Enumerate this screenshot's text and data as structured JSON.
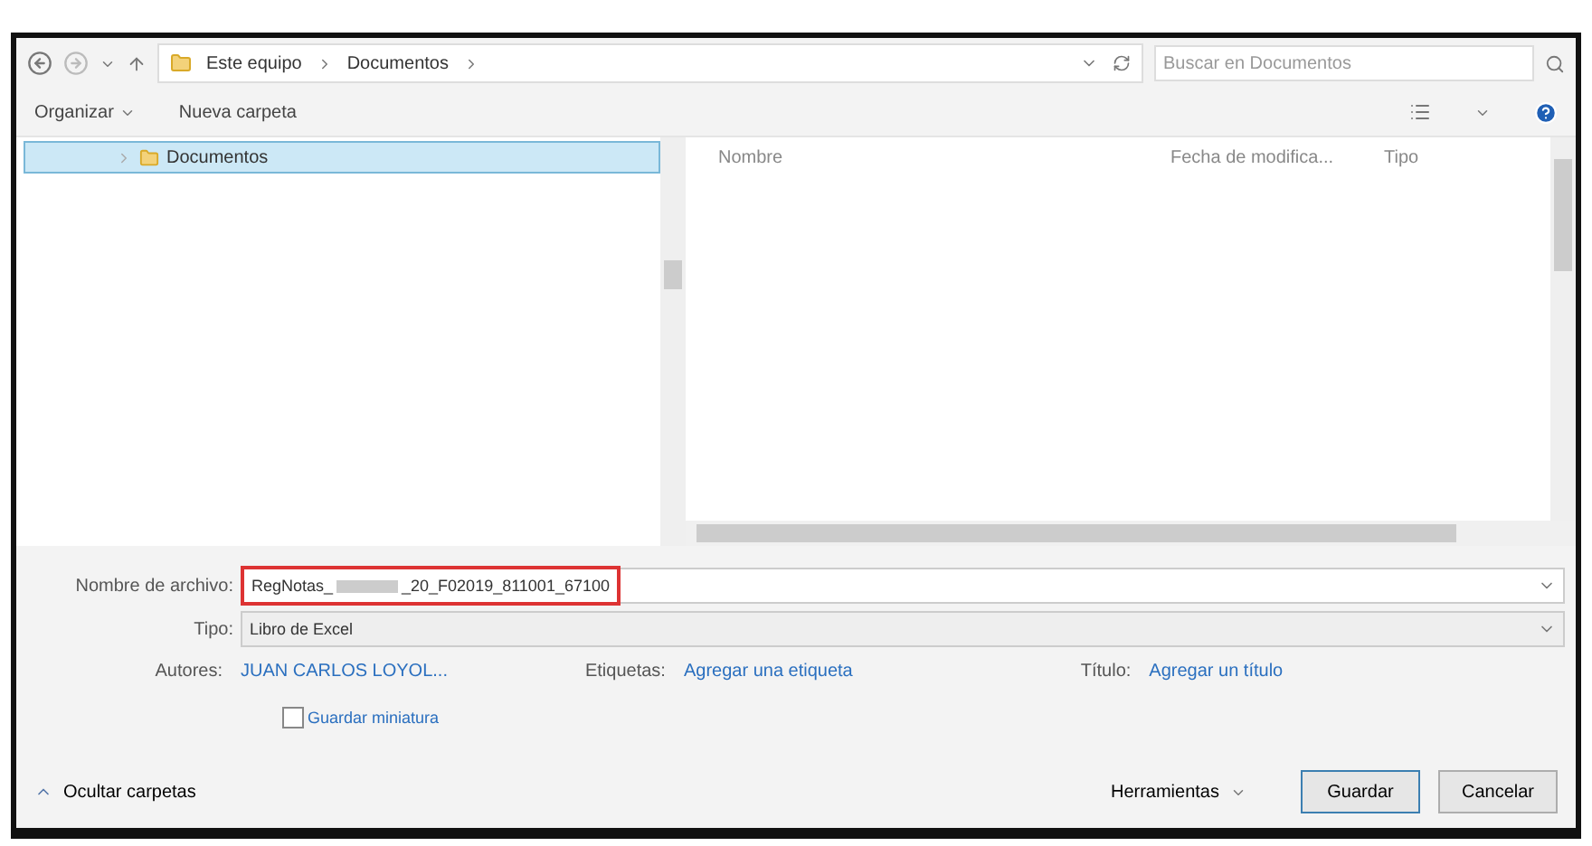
{
  "address": {
    "crumbs": [
      "Este equipo",
      "Documentos"
    ],
    "search_placeholder": "Buscar en Documentos"
  },
  "toolbar": {
    "organize": "Organizar",
    "new_folder": "Nueva carpeta"
  },
  "nav": {
    "items": [
      {
        "label": "Documentos",
        "selected": true
      }
    ]
  },
  "files": {
    "columns": [
      "Nombre",
      "Fecha de modifica...",
      "Tipo"
    ]
  },
  "form": {
    "filename_label": "Nombre de archivo:",
    "filename_start": "RegNotas_",
    "filename_end": "_20_F02019_811001_67100",
    "type_label": "Tipo:",
    "type_value": "Libro de Excel",
    "authors_label": "Autores:",
    "authors_value": "JUAN CARLOS LOYOL...",
    "tags_label": "Etiquetas:",
    "tags_value": "Agregar una etiqueta",
    "title_label": "Título:",
    "title_value": "Agregar un título",
    "thumbnail": {
      "label": "Guardar miniatura",
      "checked": false
    }
  },
  "footer": {
    "hide_folders": "Ocultar carpetas",
    "tools": "Herramientas",
    "save": "Guardar",
    "cancel": "Cancelar"
  }
}
